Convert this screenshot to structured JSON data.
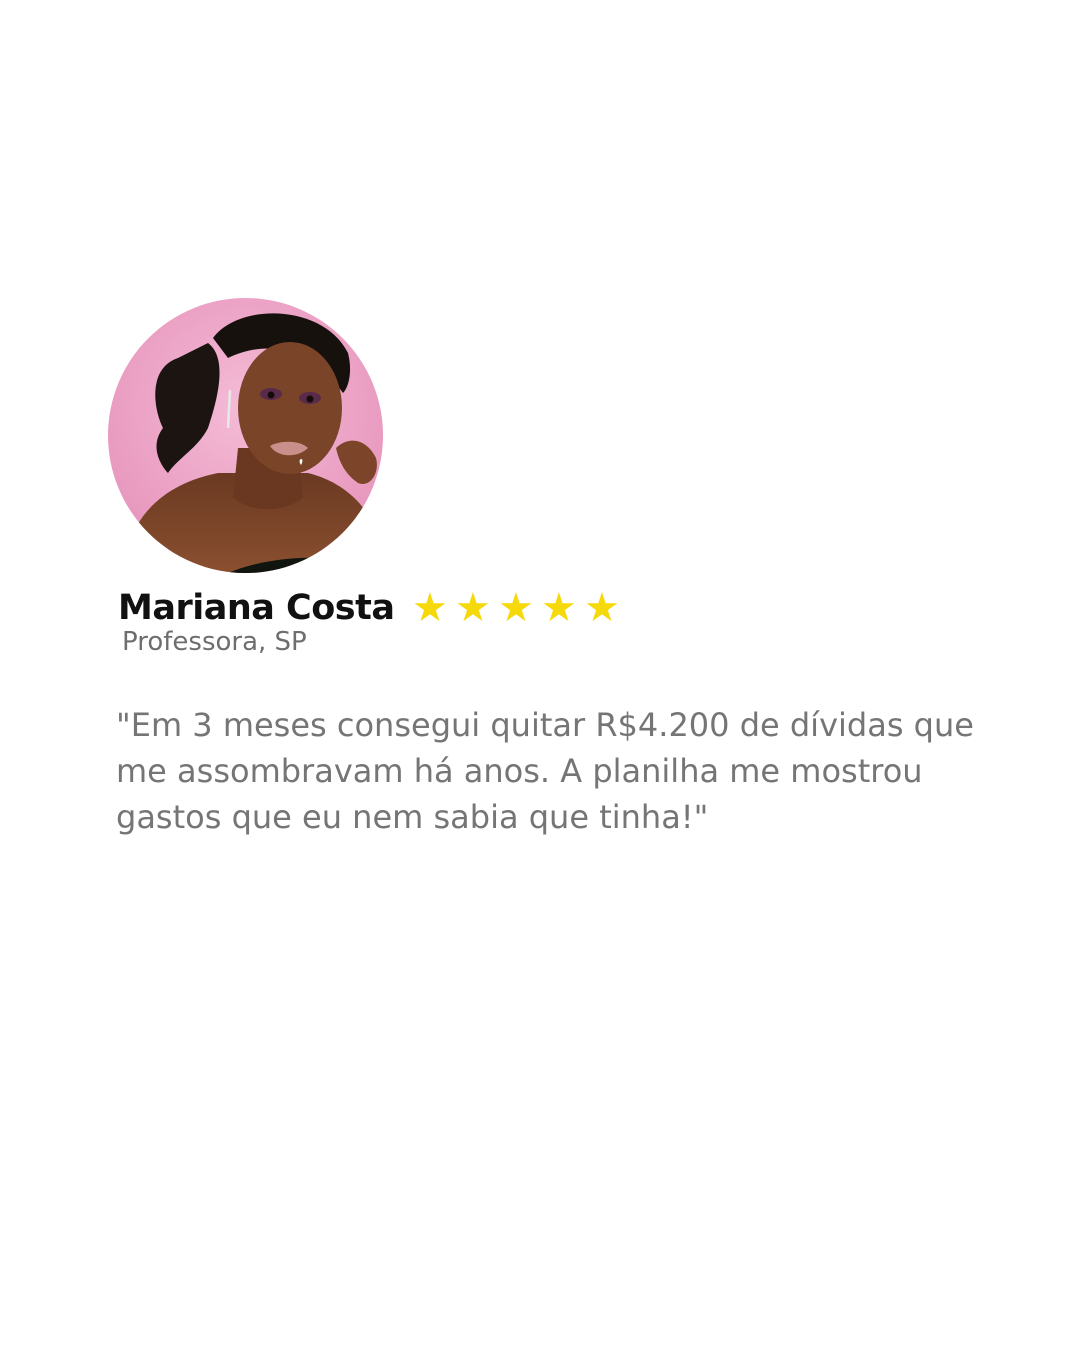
{
  "testimonial": {
    "author": {
      "name": "Mariana Costa",
      "role": "Professora, SP"
    },
    "rating": {
      "value": 5,
      "max": 5,
      "star_glyph": "★",
      "star_color": "#f5d90a"
    },
    "quote_lines": [
      "\"Em 3 meses consegui quitar R$4.200 de dívidas que",
      "me assombravam há anos. A planilha me mostrou",
      "gastos que eu nem sabia que tinha!\""
    ]
  },
  "colors": {
    "background": "#ffffff",
    "name": "#111111",
    "role": "#6e6e6e",
    "quote": "#757575",
    "avatar_background": "#e9a9c8"
  }
}
